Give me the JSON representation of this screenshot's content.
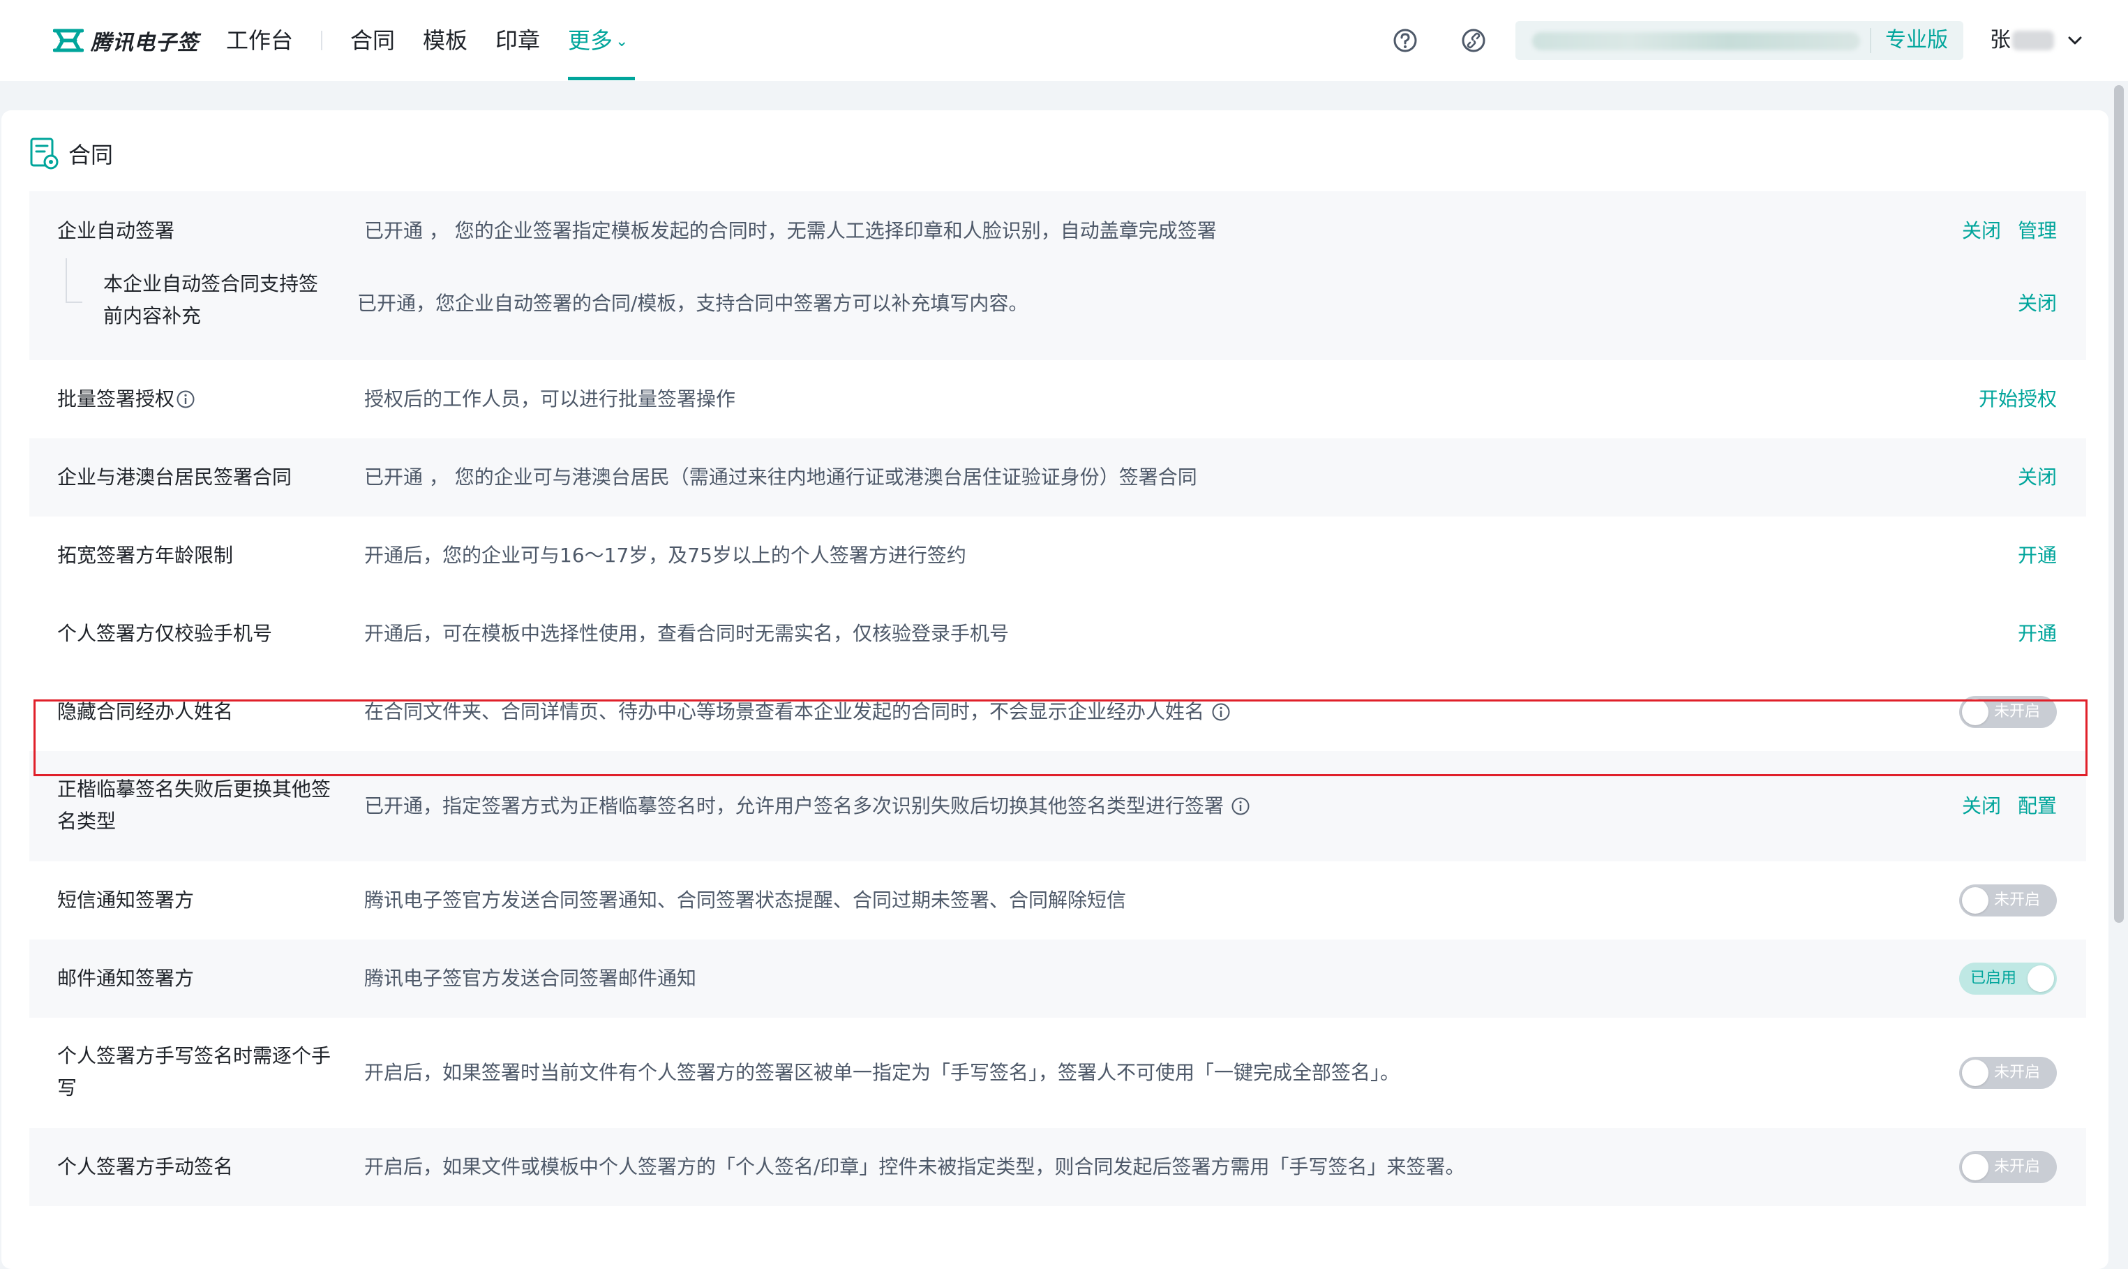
{
  "nav": {
    "logo_text": "腾讯电子签",
    "workbench": "工作台",
    "contract": "合同",
    "template": "模板",
    "seal": "印章",
    "more": "更多",
    "org_plan": "专业版",
    "user_name": "张"
  },
  "section": {
    "title": "合同"
  },
  "rows": {
    "r0": {
      "label": "企业自动签署",
      "desc": "已开通 ，  您的企业签署指定模板发起的合同时，无需人工选择印章和人脸识别，自动盖章完成签署",
      "action1": "关闭",
      "action2": "管理"
    },
    "r0s": {
      "label": "本企业自动签合同支持签前内容补充",
      "desc": "已开通，您企业自动签署的合同/模板，支持合同中签署方可以补充填写内容。",
      "action1": "关闭"
    },
    "r1": {
      "label": "批量签署授权",
      "desc": "授权后的工作人员，可以进行批量签署操作",
      "action1": "开始授权"
    },
    "r2": {
      "label": "企业与港澳台居民签署合同",
      "desc": "已开通 ，  您的企业可与港澳台居民（需通过来往内地通行证或港澳台居住证验证身份）签署合同",
      "action1": "关闭"
    },
    "r3": {
      "label": "拓宽签署方年龄限制",
      "desc": "开通后，您的企业可与16～17岁，及75岁以上的个人签署方进行签约",
      "action1": "开通"
    },
    "r4": {
      "label": "个人签署方仅校验手机号",
      "desc": "开通后，可在模板中选择性使用，查看合同时无需实名，仅核验登录手机号",
      "action1": "开通"
    },
    "r5": {
      "label": "隐藏合同经办人姓名",
      "desc": "在合同文件夹、合同详情页、待办中心等场景查看本企业发起的合同时，不会显示企业经办人姓名",
      "toggle": "未开启"
    },
    "r6": {
      "label": "正楷临摹签名失败后更换其他签名类型",
      "desc": "已开通，指定签署方式为正楷临摹签名时，允许用户签名多次识别失败后切换其他签名类型进行签署",
      "action1": "关闭",
      "action2": "配置"
    },
    "r7": {
      "label": "短信通知签署方",
      "desc": "腾讯电子签官方发送合同签署通知、合同签署状态提醒、合同过期未签署、合同解除短信",
      "toggle": "未开启"
    },
    "r8": {
      "label": "邮件通知签署方",
      "desc": "腾讯电子签官方发送合同签署邮件通知",
      "toggle": "已启用"
    },
    "r9": {
      "label": "个人签署方手写签名时需逐个手写",
      "desc": "开启后，如果签署时当前文件有个人签署方的签署区被单一指定为「手写签名」，签署人不可使用「一键完成全部签名」。",
      "toggle": "未开启"
    },
    "r10": {
      "label": "个人签署方手动签名",
      "desc": "开启后，如果文件或模板中个人签署方的「个人签名/印章」控件未被指定类型，则合同发起后签署方需用「手写签名」来签署。",
      "toggle": "未开启"
    }
  },
  "colors": {
    "accent": "#00a59b",
    "highlight": "#e0202a",
    "toggle_off": "#c9cdd4",
    "toggle_on": "#bfe8e4"
  },
  "icons": {
    "logo": "tencent-esign-logo-icon",
    "help": "question-circle-icon",
    "link": "link-circle-icon",
    "user_menu": "chevron-down-icon",
    "section": "contract-document-icon",
    "info": "info-circle-icon"
  }
}
